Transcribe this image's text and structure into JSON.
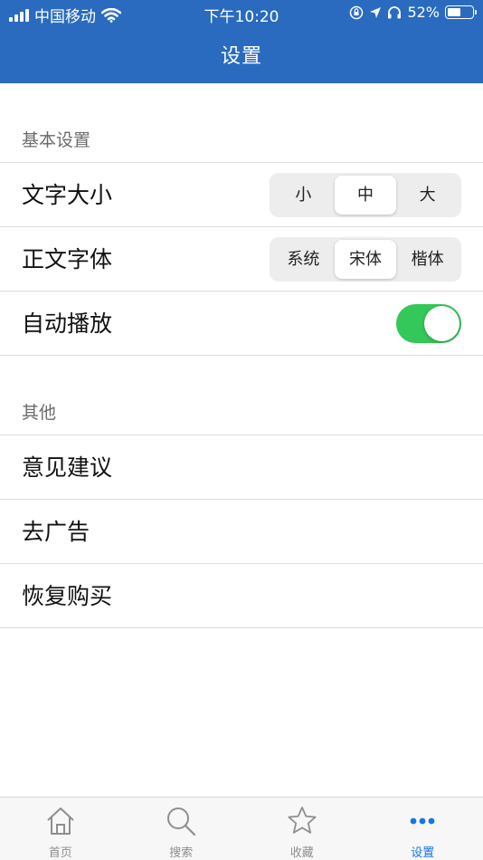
{
  "status_bar": {
    "carrier": "中国移动",
    "time": "下午10:20",
    "battery": "52%",
    "battery_level": 0.52
  },
  "nav": {
    "title": "设置"
  },
  "sections": {
    "basic": {
      "header": "基本设置",
      "font_size": {
        "label": "文字大小",
        "options": [
          "小",
          "中",
          "大"
        ],
        "selected": "中"
      },
      "body_font": {
        "label": "正文字体",
        "options": [
          "系统",
          "宋体",
          "楷体"
        ],
        "selected": "宋体"
      },
      "autoplay": {
        "label": "自动播放",
        "on": true
      }
    },
    "other": {
      "header": "其他",
      "items": [
        "意见建议",
        "去广告",
        "恢复购买"
      ]
    }
  },
  "tabbar": {
    "tabs": [
      {
        "label": "首页",
        "icon": "home-icon"
      },
      {
        "label": "搜索",
        "icon": "search-icon"
      },
      {
        "label": "收藏",
        "icon": "star-icon"
      },
      {
        "label": "设置",
        "icon": "more-icon"
      }
    ],
    "active": "设置"
  },
  "colors": {
    "nav_bg": "#2a6bc0",
    "toggle_on": "#34c759",
    "tab_active": "#1a73e8"
  }
}
